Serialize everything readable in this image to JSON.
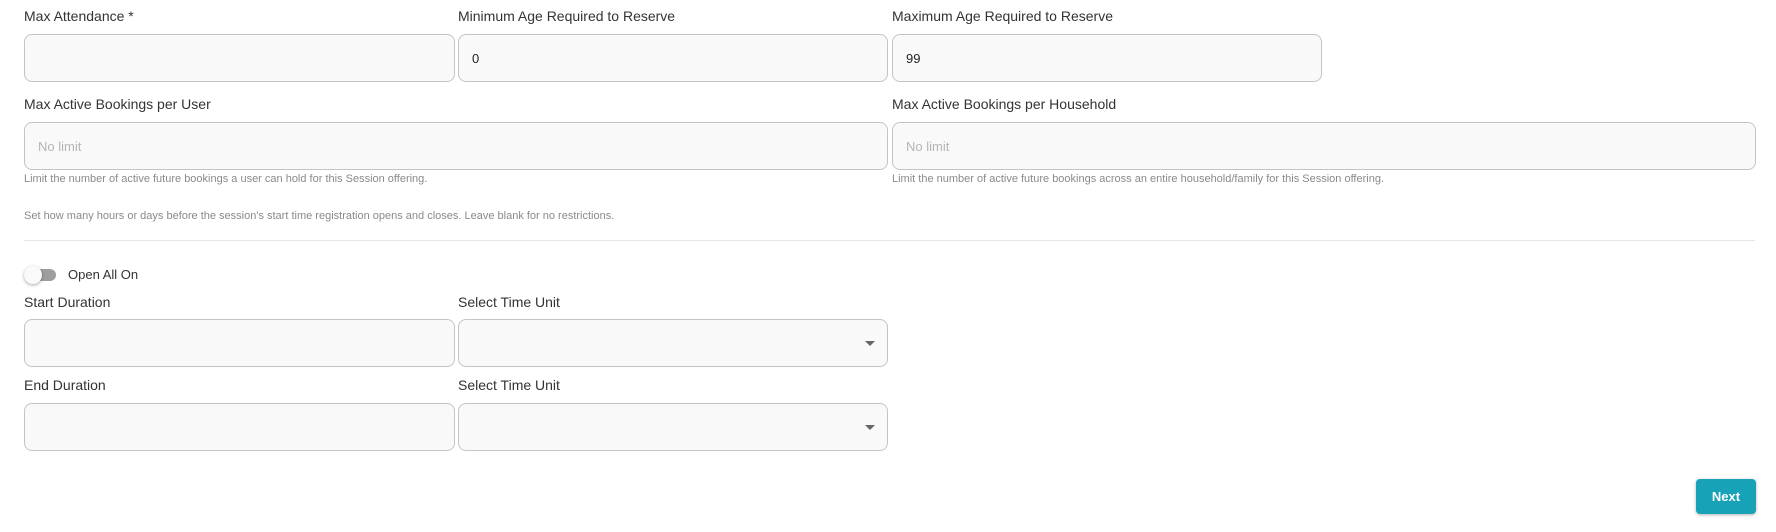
{
  "row1": {
    "max_attendance": {
      "label": "Max Attendance *",
      "value": "",
      "placeholder": ""
    },
    "min_age": {
      "label": "Minimum Age Required to Reserve",
      "value": "0"
    },
    "max_age": {
      "label": "Maximum Age Required to Reserve",
      "value": "99"
    }
  },
  "row2": {
    "per_user": {
      "label": "Max Active Bookings per User",
      "placeholder": "No limit",
      "help": "Limit the number of active future bookings a user can hold for this Session offering."
    },
    "per_household": {
      "label": "Max Active Bookings per Household",
      "placeholder": "No limit",
      "help": "Limit the number of active future bookings across an entire household/family for this Session offering."
    }
  },
  "registration_help": "Set how many hours or days before the session's start time registration opens and closes. Leave blank for no restrictions.",
  "toggle": {
    "label": "Open All On",
    "on": false
  },
  "start": {
    "duration_label": "Start Duration",
    "duration_value": "",
    "unit_label": "Select Time Unit",
    "unit_value": ""
  },
  "end": {
    "duration_label": "End Duration",
    "duration_value": "",
    "unit_label": "Select Time Unit",
    "unit_value": ""
  },
  "next_label": "Next",
  "icons": {
    "select_caret": "caret-down-icon"
  },
  "colors": {
    "accent": "#17a2b8",
    "toggle_track": "#9e9e9e",
    "field_bg": "#f9f9f9"
  }
}
